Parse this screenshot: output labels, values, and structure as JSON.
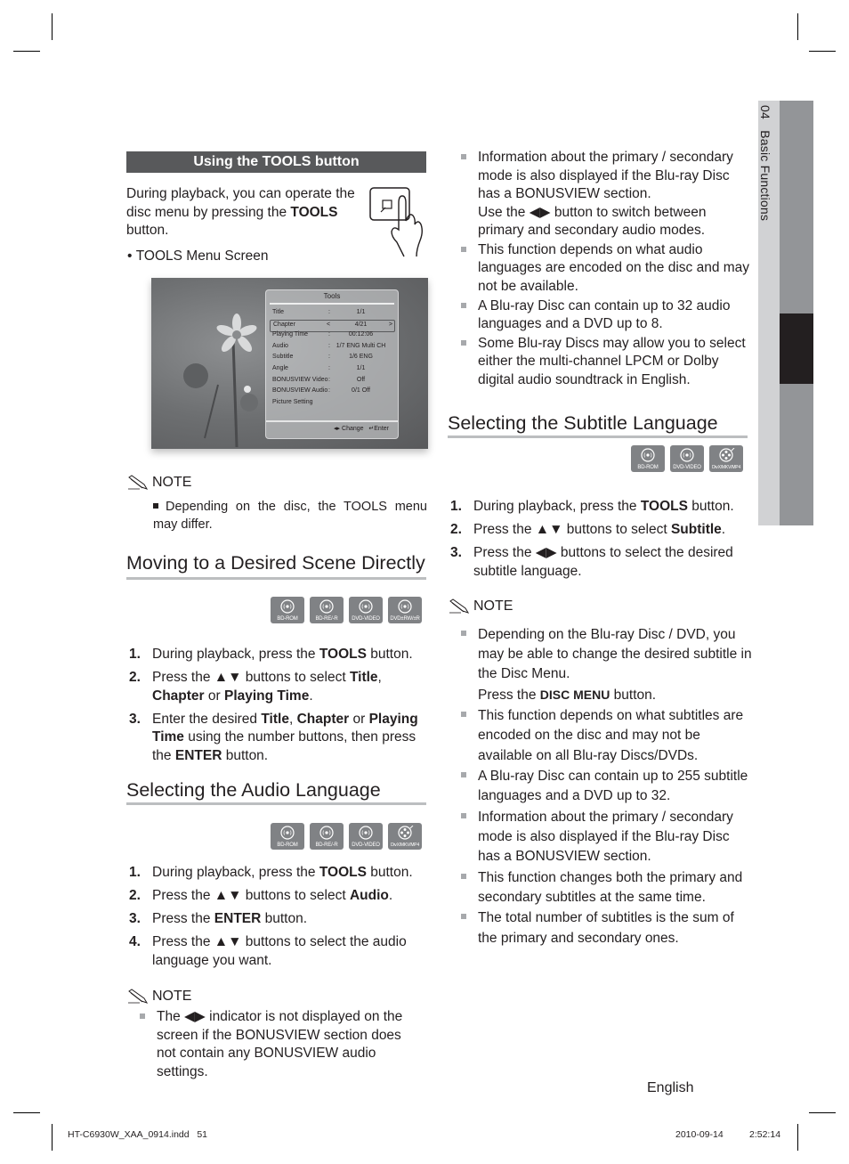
{
  "side_tab": {
    "chapter_number": "04",
    "chapter_title": "Basic Functions"
  },
  "left": {
    "tools_section": {
      "banner": "Using the TOOLS button",
      "intro_parts": [
        "During playback, you can operate the disc menu by pressing the ",
        "TOOLS",
        " button."
      ],
      "bullet": "TOOLS Menu Screen",
      "tools_menu": {
        "title": "Tools",
        "rows": [
          {
            "label": "Title",
            "value": "1/1"
          },
          {
            "label": "Chapter",
            "value": "4/21",
            "selected": true
          },
          {
            "label": "Playing Time",
            "value": "00:12:06"
          },
          {
            "label": "Audio",
            "value": "1/7 ENG Multi CH"
          },
          {
            "label": "Subtitle",
            "value": "1/6 ENG"
          },
          {
            "label": "Angle",
            "value": "1/1"
          },
          {
            "label": "BONUSVIEW Video",
            "value": "Off"
          },
          {
            "label": "BONUSVIEW Audio",
            "value": "0/1 Off"
          },
          {
            "label": "Picture Setting",
            "value": ""
          }
        ],
        "footer_change": "◂▸ Change",
        "footer_enter": "Enter"
      },
      "note_label": "NOTE",
      "note": "Depending on the disc, the TOOLS menu may differ."
    },
    "scene_section": {
      "heading": "Moving to a Desired Scene Directly",
      "badges": [
        "BD-ROM",
        "BD-RE/-R",
        "DVD-VIDEO",
        "DVD±RW/±R"
      ],
      "steps": [
        {
          "num": "1.",
          "parts": [
            [
              "During playback, press the ",
              false
            ],
            [
              "TOOLS",
              true
            ],
            [
              " button.",
              false
            ]
          ]
        },
        {
          "num": "2.",
          "parts": [
            [
              "Press the ▲▼ buttons to select ",
              false
            ],
            [
              "Title",
              true
            ],
            [
              ", ",
              false
            ],
            [
              "Chapter",
              true
            ],
            [
              " or ",
              false
            ],
            [
              "Playing Time",
              true
            ],
            [
              ".",
              false
            ]
          ]
        },
        {
          "num": "3.",
          "parts": [
            [
              "Enter the desired ",
              false
            ],
            [
              "Title",
              true
            ],
            [
              ", ",
              false
            ],
            [
              "Chapter",
              true
            ],
            [
              " or ",
              false
            ],
            [
              "Playing Time",
              true
            ],
            [
              " using the number buttons, then press the ",
              false
            ],
            [
              "ENTER",
              true
            ],
            [
              " button.",
              false
            ]
          ]
        }
      ]
    },
    "audio_section": {
      "heading": "Selecting the Audio Language",
      "badges": [
        "BD-ROM",
        "BD-RE/-R",
        "DVD-VIDEO",
        "DivX/MKV/MP4"
      ],
      "steps": [
        {
          "num": "1.",
          "parts": [
            [
              "During playback, press the ",
              false
            ],
            [
              "TOOLS",
              true
            ],
            [
              " button.",
              false
            ]
          ]
        },
        {
          "num": "2.",
          "parts": [
            [
              "Press the ▲▼ buttons to select ",
              false
            ],
            [
              "Audio",
              true
            ],
            [
              ".",
              false
            ]
          ]
        },
        {
          "num": "3.",
          "parts": [
            [
              "Press the ",
              false
            ],
            [
              "ENTER",
              true
            ],
            [
              " button.",
              false
            ]
          ]
        },
        {
          "num": "4.",
          "parts": [
            [
              "Press the ▲▼ buttons to select the audio language you want.",
              false
            ]
          ]
        }
      ],
      "note_label": "NOTE",
      "notes": [
        "The ◀▶ indicator is not displayed on the screen if the BONUSVIEW section does not contain any BONUSVIEW audio settings."
      ]
    }
  },
  "right": {
    "audio_notes_cont": [
      [
        "Information about the primary / secondary mode is also displayed if the Blu-ray Disc has a BONUSVIEW section.",
        "Use the ◀▶ button to switch between primary and secondary audio modes."
      ],
      [
        "This function depends on what audio languages are encoded on the disc and may not be available."
      ],
      [
        "A Blu-ray Disc can contain up to 32 audio languages and a DVD up to 8."
      ],
      [
        "Some Blu-ray Discs may allow you to select either the multi-channel LPCM or Dolby digital audio soundtrack in English."
      ]
    ],
    "subtitle_section": {
      "heading": "Selecting the Subtitle Language",
      "badges": [
        "BD-ROM",
        "DVD-VIDEO",
        "DivX/MKV/MP4"
      ],
      "steps": [
        {
          "num": "1.",
          "parts": [
            [
              "During playback, press the ",
              false
            ],
            [
              "TOOLS",
              true
            ],
            [
              " button.",
              false
            ]
          ]
        },
        {
          "num": "2.",
          "parts": [
            [
              "Press the ▲▼ buttons to select ",
              false
            ],
            [
              "Subtitle",
              true
            ],
            [
              ".",
              false
            ]
          ]
        },
        {
          "num": "3.",
          "parts": [
            [
              "Press the ◀▶ buttons to select the desired subtitle language.",
              false
            ]
          ]
        }
      ],
      "note_label": "NOTE",
      "notes": [
        {
          "text": "Depending on the Blu-ray Disc / DVD, you may be able to change the desired subtitle in the Disc Menu.",
          "extra_prefix": "Press the ",
          "extra_bold": "DISC MENU",
          "extra_suffix": " button."
        },
        {
          "text": "This function depends on what subtitles are encoded on the disc and may not be available on all Blu-ray Discs/DVDs."
        },
        {
          "text": "A Blu-ray Disc can contain up to 255 subtitle languages and a DVD up to 32."
        },
        {
          "text": "Information about the primary / secondary mode is also displayed if the Blu-ray Disc has a BONUSVIEW section."
        },
        {
          "text": "This function changes both the primary and secondary subtitles at the same time."
        },
        {
          "text": "The total number of subtitles is the sum of the primary and secondary ones."
        }
      ]
    }
  },
  "footer": {
    "language": "English",
    "file_name": "HT-C6930W_XAA_0914.indd   51",
    "date": "2010-09-14",
    "time": "2:52:14"
  }
}
